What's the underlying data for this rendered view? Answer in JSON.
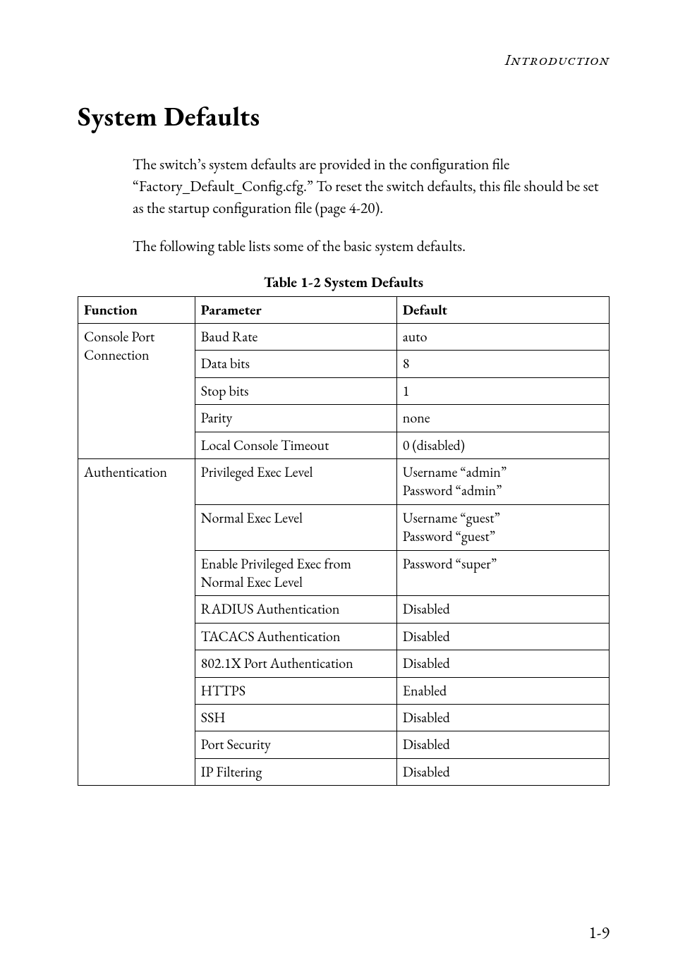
{
  "running_head": "Introduction",
  "section_title": "System Defaults",
  "paragraphs": {
    "p1": "The switch’s system defaults are provided in the configuration file “Factory_Default_Config.cfg.” To reset the switch defaults, this file should be set as the startup configuration file (page 4-20).",
    "p2": "The following table lists some of the basic system defaults."
  },
  "table_caption": "Table 1-2  System Defaults",
  "table_headers": {
    "function": "Function",
    "parameter": "Parameter",
    "default": "Default"
  },
  "groups": [
    {
      "function": "Console Port Connection",
      "rows": [
        {
          "parameter": "Baud Rate",
          "default": "auto"
        },
        {
          "parameter": "Data bits",
          "default": "8"
        },
        {
          "parameter": "Stop bits",
          "default": "1"
        },
        {
          "parameter": "Parity",
          "default": "none"
        },
        {
          "parameter": "Local Console Timeout",
          "default": "0 (disabled)"
        }
      ]
    },
    {
      "function": "Authentication",
      "rows": [
        {
          "parameter": "Privileged Exec Level",
          "default": "Username “admin”\nPassword “admin”"
        },
        {
          "parameter": "Normal Exec Level",
          "default": "Username “guest”\nPassword “guest”"
        },
        {
          "parameter": "Enable Privileged Exec from Normal Exec Level",
          "default": "Password “super”"
        },
        {
          "parameter": "RADIUS Authentication",
          "default": "Disabled"
        },
        {
          "parameter": "TACACS Authentication",
          "default": "Disabled"
        },
        {
          "parameter": "802.1X Port Authentication",
          "default": "Disabled"
        },
        {
          "parameter": "HTTPS",
          "default": "Enabled"
        },
        {
          "parameter": "SSH",
          "default": "Disabled"
        },
        {
          "parameter": "Port Security",
          "default": "Disabled"
        },
        {
          "parameter": "IP Filtering",
          "default": "Disabled"
        }
      ]
    }
  ],
  "page_number": "1-9"
}
